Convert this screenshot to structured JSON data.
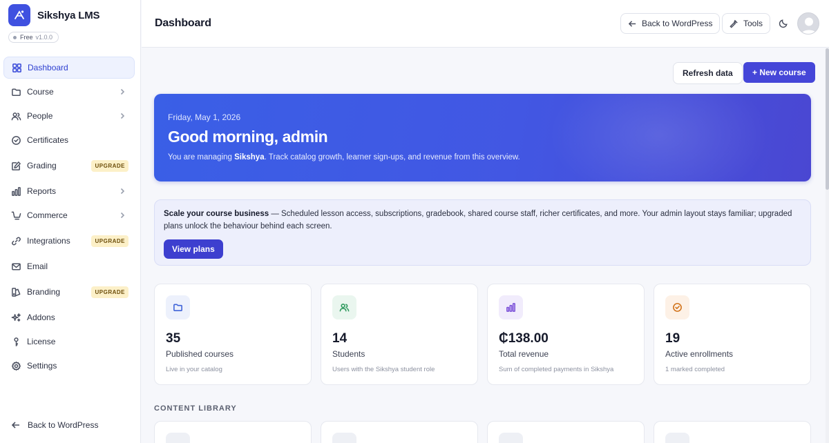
{
  "app": {
    "name": "Sikshya LMS",
    "plan": "Free",
    "version": "v1.0.0"
  },
  "sidebar": {
    "items": [
      {
        "label": "Dashboard",
        "icon": "dashboard-icon"
      },
      {
        "label": "Course",
        "icon": "folder-icon"
      },
      {
        "label": "People",
        "icon": "users-icon"
      },
      {
        "label": "Certificates",
        "icon": "check-circle-icon"
      },
      {
        "label": "Grading",
        "icon": "edit-icon",
        "badge": "UPGRADE"
      },
      {
        "label": "Reports",
        "icon": "bar-chart-icon"
      },
      {
        "label": "Commerce",
        "icon": "cart-icon"
      },
      {
        "label": "Integrations",
        "icon": "link-icon",
        "badge": "UPGRADE"
      },
      {
        "label": "Email",
        "icon": "mail-icon"
      },
      {
        "label": "Branding",
        "icon": "palette-icon",
        "badge": "UPGRADE"
      },
      {
        "label": "Addons",
        "icon": "sparkles-icon"
      },
      {
        "label": "License",
        "icon": "key-icon"
      },
      {
        "label": "Settings",
        "icon": "gear-icon"
      }
    ],
    "footer_label": "Back to WordPress"
  },
  "header": {
    "title": "Dashboard",
    "back_label": "Back to WordPress",
    "tools_label": "Tools"
  },
  "actions": {
    "refresh_label": "Refresh data",
    "new_course_label": "+ New course"
  },
  "hero": {
    "date": "Friday, May 1, 2026",
    "greeting": "Good morning, admin",
    "desc_prefix": "You are managing ",
    "desc_site": "Sikshya",
    "desc_suffix": ". Track catalog growth, learner sign-ups, and revenue from this overview."
  },
  "promo": {
    "title": "Scale your course business",
    "text": " — Scheduled lesson access, subscriptions, gradebook, shared course staff, richer certificates, and more. Your admin layout stays familiar; upgraded plans unlock the behaviour behind each screen.",
    "button": "View plans"
  },
  "stats": [
    {
      "value": "35",
      "label": "Published courses",
      "sub": "Live in your catalog",
      "icon": "folder-icon",
      "color": "#3f63d8",
      "bg": "#edf1fc"
    },
    {
      "value": "14",
      "label": "Students",
      "sub": "Users with the Sikshya student role",
      "icon": "users-icon",
      "color": "#2f9a5e",
      "bg": "#eaf6ef"
    },
    {
      "value": "₵138.00",
      "label": "Total revenue",
      "sub": "Sum of completed payments in Sikshya",
      "icon": "bar-chart-icon",
      "color": "#7a4fd8",
      "bg": "#f1ecfc"
    },
    {
      "value": "19",
      "label": "Active enrollments",
      "sub": "1 marked completed",
      "icon": "check-circle-icon",
      "color": "#d2741c",
      "bg": "#fdf1e6"
    }
  ],
  "content_library": {
    "title": "CONTENT LIBRARY"
  },
  "colors": {
    "accent": "#4546d8",
    "hero_start": "#3a5fe6",
    "hero_end": "#4a47d2",
    "upgrade_bg": "#fcf0c8"
  }
}
